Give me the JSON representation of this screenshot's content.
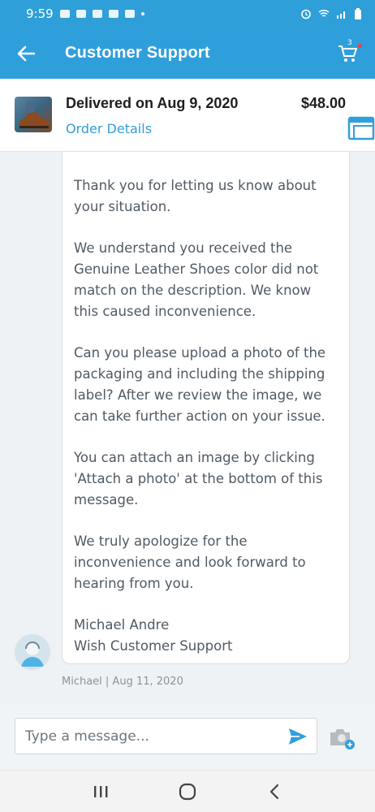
{
  "status_bar": {
    "time": "9:59"
  },
  "app_bar": {
    "title": "Customer Support",
    "cart_count": "3"
  },
  "order": {
    "status": "Delivered on Aug 9, 2020",
    "price": "$48.00",
    "details_link": "Order Details"
  },
  "message": {
    "paragraphs": [
      "Thank you for letting us know about your situation.",
      "We understand you received the Genuine Leather Shoes color did not match on the description. We know this caused inconvenience.",
      "Can you please upload a photo of the packaging and including the shipping label? After we review the image, we can take further action on your issue.",
      "You can attach an image by clicking 'Attach a photo' at the bottom of this message.",
      "We truly apologize for the inconvenience and look forward to hearing from you."
    ],
    "signature_name": "Michael Andre",
    "signature_team": "Wish Customer Support",
    "meta": "Michael | Aug 11, 2020"
  },
  "composer": {
    "placeholder": "Type a message..."
  },
  "colors": {
    "brand": "#2f9fdc",
    "text": "#505a63",
    "cart_dot": "#ff3b3b"
  }
}
